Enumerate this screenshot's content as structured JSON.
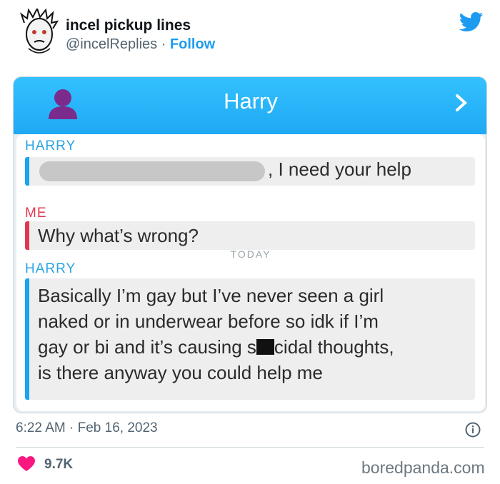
{
  "tweet": {
    "display_name": "incel pickup lines",
    "handle": "@incelReplies",
    "separator": " · ",
    "follow_label": "Follow",
    "time": "6:22 AM",
    "date": "Feb 16, 2023",
    "likes": "9.7K"
  },
  "chat": {
    "title": "Harry",
    "today_label": "TODAY",
    "messages": [
      {
        "sender": "HARRY",
        "text": ", I need your help"
      },
      {
        "sender": "ME",
        "text": "Why what’s wrong?"
      },
      {
        "sender": "HARRY",
        "line1": "Basically I’m gay but I’ve never seen a girl",
        "line2": "naked or in underwear before so idk if I’m",
        "line3a": "gay or bi and it’s causing s",
        "line3b": "cidal thoughts,",
        "line4": "is there anyway you could help me"
      }
    ]
  },
  "watermark": "boredpanda.com",
  "colors": {
    "twitter_blue": "#1d9bf0",
    "snap_blue": "#29a4e2",
    "me_red": "#e0394f",
    "heart_pink": "#f91880"
  }
}
